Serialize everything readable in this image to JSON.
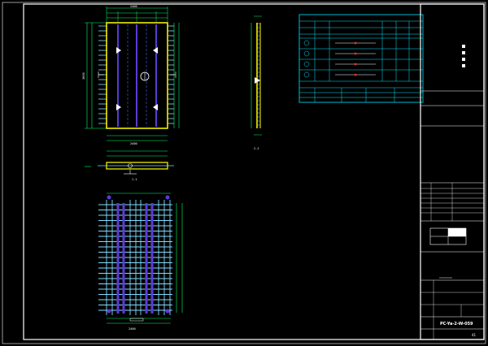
{
  "drawing_number": "PC-Ya-2-W-059",
  "view_labels": {
    "section_right": "2-2",
    "section_bottom": "1-1"
  },
  "sheet_number": "41",
  "colors": {
    "background": "#000000",
    "border": "#ffffff",
    "outline": "#ffff00",
    "dimension": "#00ff66",
    "rebar_cyan": "#7fdcff",
    "rebar_purple": "#5b3bd6",
    "table_line": "#00e5ff",
    "marker_red": "#ff2a2a"
  }
}
